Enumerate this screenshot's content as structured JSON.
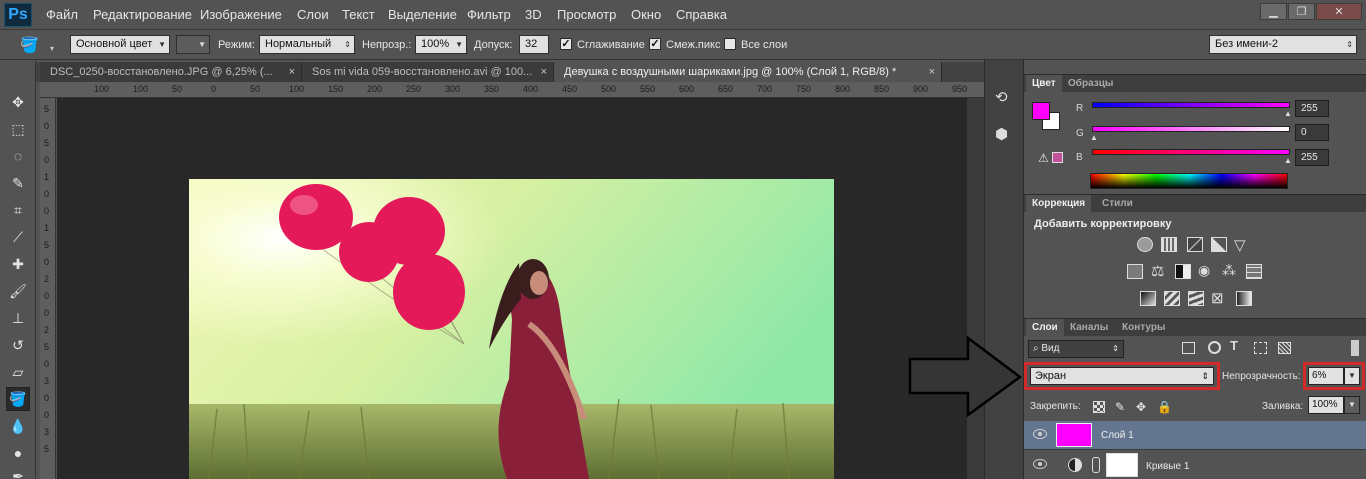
{
  "app": {
    "logo": "Ps",
    "name": "Adobe Photoshop"
  },
  "menu": [
    "Файл",
    "Редактирование",
    "Изображение",
    "Слои",
    "Текст",
    "Выделение",
    "Фильтр",
    "3D",
    "Просмотр",
    "Окно",
    "Справка"
  ],
  "window_controls": {
    "minimize": "▁",
    "restore": "❐",
    "close": "✕"
  },
  "options": {
    "fill_source": "Основной цвет",
    "mode_label": "Режим:",
    "mode_value": "Нормальный",
    "opacity_label": "Непрозр.:",
    "opacity_value": "100%",
    "tolerance_label": "Допуск:",
    "tolerance_value": "32",
    "antialias_label": "Сглаживание",
    "contiguous_label": "Смеж.пикс",
    "all_layers_label": "Все слои",
    "workspace_value": "Без имени-2"
  },
  "tabs": [
    {
      "label": "DSC_0250-восстановлено.JPG @ 6,25% (...",
      "close": "×"
    },
    {
      "label": "Sos mi vida 059-восстановлено.avi @ 100...",
      "close": "×"
    },
    {
      "label": "Девушка с воздушными шариками.jpg @ 100% (Слой 1, RGB/8) *",
      "close": "×"
    }
  ],
  "ruler_top": [
    "100",
    "100",
    "50",
    "0",
    "50",
    "100",
    "150",
    "200",
    "250",
    "300",
    "350",
    "400",
    "450",
    "500",
    "550",
    "600",
    "650",
    "700",
    "750",
    "800",
    "850",
    "900",
    "950"
  ],
  "ruler_left": [
    "5",
    "0",
    "5",
    "0",
    "1",
    "0",
    "0",
    "1",
    "5",
    "0",
    "2",
    "0",
    "0",
    "2",
    "5",
    "0",
    "3",
    "0",
    "0",
    "3",
    "5"
  ],
  "color_panel": {
    "tabs": [
      "Цвет",
      "Образцы"
    ],
    "foreground": "#ff00ff",
    "background": "#ffffff",
    "r": {
      "label": "R",
      "value": "255"
    },
    "g": {
      "label": "G",
      "value": "0"
    },
    "b": {
      "label": "B",
      "value": "255"
    }
  },
  "adjustments_panel": {
    "tabs": [
      "Коррекция",
      "Стили"
    ],
    "heading": "Добавить корректировку"
  },
  "layers_panel": {
    "tabs": [
      "Слои",
      "Каналы",
      "Контуры"
    ],
    "filter_kind": "Вид",
    "blend_mode": "Экран",
    "opacity_label": "Непрозрачность:",
    "opacity_value": "6%",
    "lock_label": "Закрепить:",
    "fill_label": "Заливка:",
    "fill_value": "100%",
    "layers": [
      {
        "name": "Слой 1",
        "thumb_color": "#ff00ff",
        "selected": true
      },
      {
        "name": "Кривые 1",
        "thumb_color": "#ffffff",
        "selected": false
      }
    ]
  },
  "colors": {
    "highlight": "#d12a2a",
    "selected_layer": "#64768f",
    "panel": "#535353"
  }
}
